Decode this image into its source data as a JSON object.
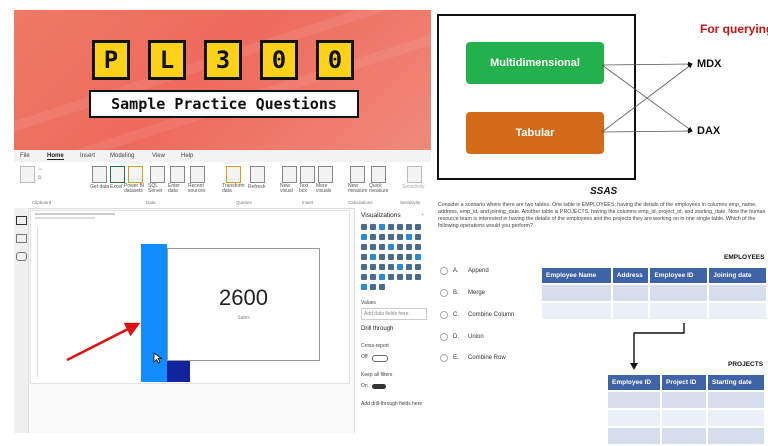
{
  "banner": {
    "tiles": [
      "P",
      "L",
      "3",
      "0",
      "0"
    ],
    "subtitle": "Sample Practice Questions"
  },
  "diagram": {
    "for_querying": "For querying",
    "box_top": "Multidimensional",
    "box_bottom": "Tabular",
    "lang_top": "MDX",
    "lang_bottom": "DAX",
    "caption": "SSAS"
  },
  "powerbi": {
    "tabs": [
      "File",
      "Home",
      "Insert",
      "Modeling",
      "View",
      "Help"
    ],
    "active_tab": "Home",
    "ribbon": [
      {
        "label": "Get data"
      },
      {
        "label": "Excel"
      },
      {
        "label": "Power BI datasets"
      },
      {
        "label": "SQL Server"
      },
      {
        "label": "Enter data"
      },
      {
        "label": "Recent sources"
      },
      {
        "label": "Transform data"
      },
      {
        "label": "Refresh"
      },
      {
        "label": "New visual"
      },
      {
        "label": "Text box"
      },
      {
        "label": "More visuals"
      },
      {
        "label": "New measure"
      },
      {
        "label": "Quick measure"
      },
      {
        "label": "Sensitivity"
      }
    ],
    "ribbon_groups": [
      "Clipboard",
      "Data",
      "Queries",
      "Insert",
      "Calculations",
      "Sensitivity"
    ],
    "visualizations_title": "Visualizations",
    "card_value": "2600",
    "card_label": "Sales",
    "values_label": "Values",
    "add_fields": "Add data fields here",
    "drill_through": "Drill through",
    "cross_report": "Cross-report",
    "off_label": "Off",
    "keep_filters": "Keep all filters",
    "on_label": "On",
    "add_drill": "Add drill-through fields here"
  },
  "question": {
    "text": "Consider a scenario where there are two tables. One table is EMPLOYEES, having the details of the employees in columns emp_name, address, emp_id, and joining_date. Another table is PROJECTS, having the columns emp_id, project_id, and starting_date. Now the human resource team is interested in having the details of the employees and the projects they are working on in one single table. Which of the following operations would you perform?",
    "options": [
      {
        "letter": "A.",
        "label": "Append"
      },
      {
        "letter": "B.",
        "label": "Merge"
      },
      {
        "letter": "C.",
        "label": "Combine Column"
      },
      {
        "letter": "D.",
        "label": "Union"
      },
      {
        "letter": "E.",
        "label": "Combine Row"
      }
    ]
  },
  "employees_table": {
    "title": "EMPLOYEES",
    "columns": [
      "Employee Name",
      "Address",
      "Employee ID",
      "Joining date"
    ]
  },
  "projects_table": {
    "title": "PROJECTS",
    "columns": [
      "Employee ID",
      "Project ID",
      "Starting date"
    ]
  },
  "colors": {
    "banner": "#ee6a5c",
    "tile": "#ffd21a",
    "multidimensional": "#22b14c",
    "tabular": "#d36a1a",
    "header_blue": "#3f63a7",
    "powerbi_blue": "#118dff",
    "powerbi_navy": "#12239e",
    "accent_red": "#cc1111"
  }
}
